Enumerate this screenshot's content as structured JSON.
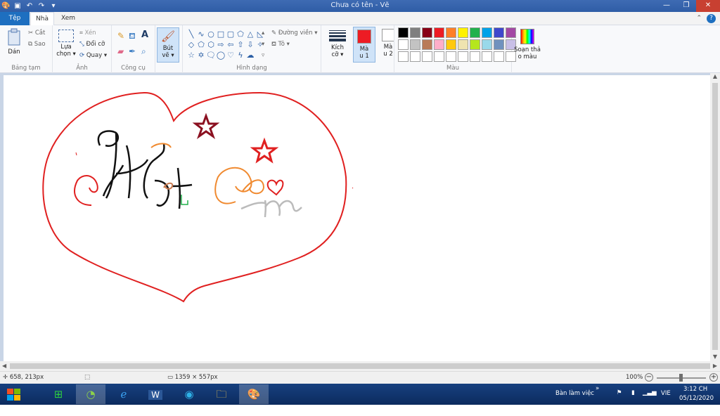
{
  "window": {
    "title": "Chưa có tên - Vẽ"
  },
  "tabs": {
    "file": "Tệp",
    "home": "Nhà",
    "view": "Xem"
  },
  "ribbon": {
    "clipboard": {
      "label": "Bảng tạm",
      "paste": "Dán",
      "cut": "Cắt",
      "copy": "Sao"
    },
    "image": {
      "label": "Ảnh",
      "select_line1": "Lựa",
      "select_line2": "chọn ▾",
      "crop": "Xén",
      "resize": "Đổi cỡ",
      "rotate": "Quay ▾"
    },
    "tools": {
      "label": "Công cụ"
    },
    "brushes": {
      "line1": "Bút",
      "line2": "vẽ ▾"
    },
    "shapes": {
      "label": "Hình dạng",
      "outline": "Đường viền ▾",
      "fill": "Tô ▾"
    },
    "size": {
      "line1": "Kích",
      "line2": "cỡ ▾"
    },
    "color1": {
      "line1": "Mà",
      "line2": "u 1",
      "value": "#ed1c24"
    },
    "color2": {
      "line1": "Mà",
      "line2": "u 2",
      "value": "#ffffff"
    },
    "colors": {
      "label": "Màu"
    },
    "edit_colors": {
      "line1": "Soạn thả",
      "line2": "o màu"
    }
  },
  "palette": [
    "#000000",
    "#7f7f7f",
    "#880015",
    "#ed1c24",
    "#ff7f27",
    "#fff200",
    "#22b14c",
    "#00a2e8",
    "#3f48cc",
    "#a349a4",
    "#ffffff",
    "#c3c3c3",
    "#b97a57",
    "#ffaec9",
    "#ffc90e",
    "#efe4b0",
    "#b5e61d",
    "#99d9ea",
    "#7092be",
    "#c8bfe7",
    "#ffffff",
    "#ffffff",
    "#ffffff",
    "#ffffff",
    "#ffffff",
    "#ffffff",
    "#ffffff",
    "#ffffff",
    "#ffffff",
    "#ffffff"
  ],
  "status": {
    "cursor_pos": "658, 213px",
    "canvas_size": "1359 × 557px",
    "zoom": "100%"
  },
  "taskbar": {
    "desktop_label": "Bàn làm việc",
    "language": "VIE",
    "time": "3:12 CH",
    "date": "05/12/2020"
  }
}
